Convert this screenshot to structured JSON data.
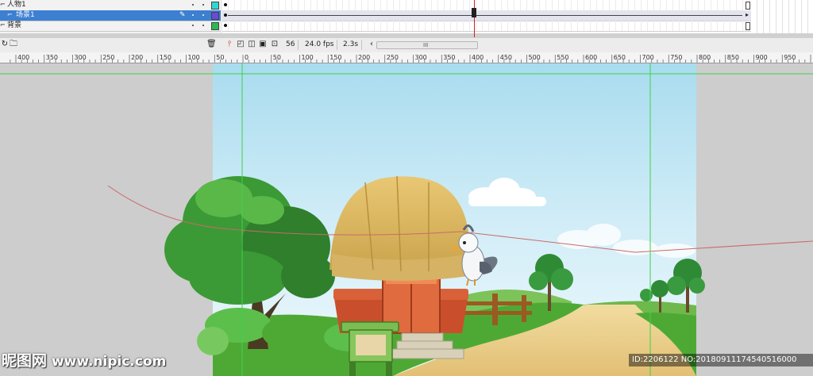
{
  "layers": [
    {
      "name": "人物1",
      "color": "#2fd6d6",
      "selected": false,
      "icon": "layer-icon"
    },
    {
      "name": "场景1",
      "color": "#6a4ad8",
      "selected": true,
      "icon": "layer-icon"
    },
    {
      "name": "背景",
      "color": "#2fb84f",
      "selected": false,
      "icon": "layer-icon"
    }
  ],
  "status": {
    "frame": "56",
    "fps": "24.0 fps",
    "time": "2.3s",
    "scroll_grip": "III"
  },
  "ruler": {
    "labels": [
      "400",
      "350",
      "300",
      "250",
      "200",
      "150",
      "100",
      "50",
      "0",
      "50",
      "100",
      "150",
      "200",
      "250",
      "300",
      "350",
      "400",
      "450",
      "500",
      "550",
      "600",
      "650",
      "700",
      "750",
      "800",
      "850",
      "900",
      "950"
    ]
  },
  "watermark": {
    "left_brand": "昵图网",
    "left_url": "www.nipic.com",
    "right_text": "ID:2206122 NO:20180911174540516000"
  },
  "colors": {
    "selection": "#3d7fd1",
    "sky_top": "#a9dcef",
    "sky_bottom": "#e9f6fb",
    "guide": "#3cd24a",
    "motion_path": "#c96a6a",
    "playhead": "#cc2222"
  }
}
